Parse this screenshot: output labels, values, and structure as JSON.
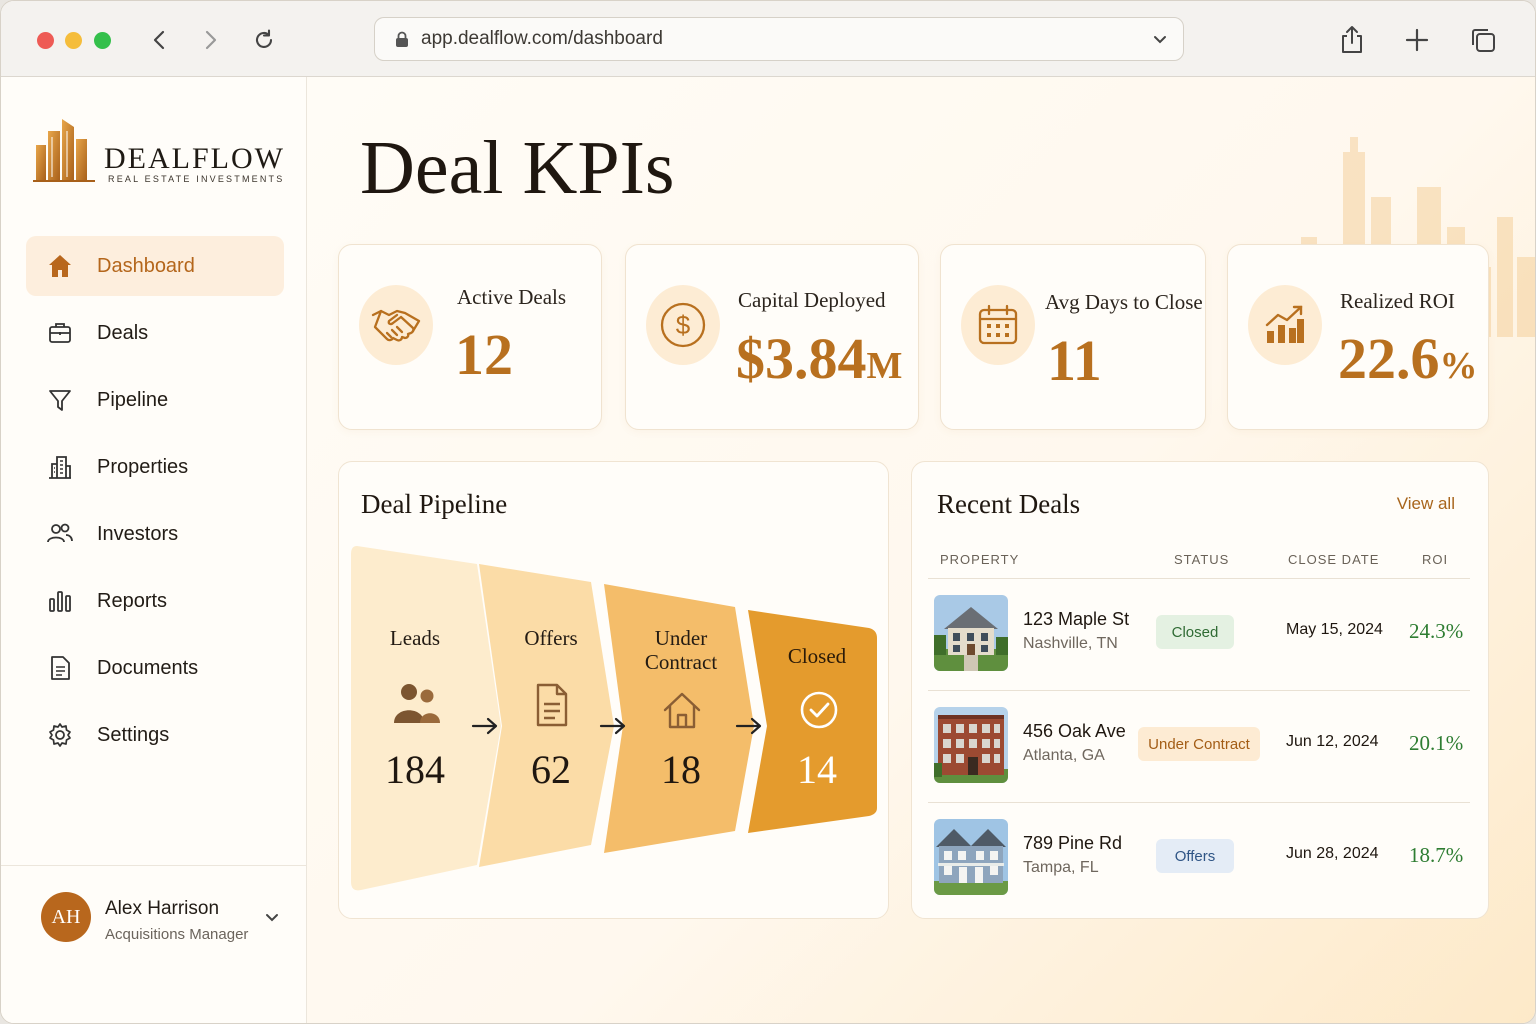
{
  "browser": {
    "url": "app.dealflow.com/dashboard"
  },
  "brand": {
    "name": "DEALFLOW",
    "tagline": "REAL ESTATE INVESTMENTS",
    "accent": "#b8701f"
  },
  "sidebar": {
    "items": [
      {
        "label": "Dashboard",
        "icon": "home-icon",
        "active": true
      },
      {
        "label": "Deals",
        "icon": "briefcase-icon"
      },
      {
        "label": "Pipeline",
        "icon": "funnel-icon"
      },
      {
        "label": "Properties",
        "icon": "building-icon"
      },
      {
        "label": "Investors",
        "icon": "users-icon"
      },
      {
        "label": "Reports",
        "icon": "bar-chart-icon"
      },
      {
        "label": "Documents",
        "icon": "document-icon"
      },
      {
        "label": "Settings",
        "icon": "gear-icon"
      }
    ]
  },
  "user": {
    "initials": "AH",
    "name": "Alex Harrison",
    "role": "Acquisitions Manager"
  },
  "page": {
    "title": "Deal KPIs"
  },
  "kpis": [
    {
      "label": "Active Deals",
      "value": "12",
      "suffix": "",
      "icon": "handshake-icon"
    },
    {
      "label": "Capital Deployed",
      "value": "$3.84",
      "suffix": "M",
      "icon": "dollar-icon"
    },
    {
      "label": "Avg Days to Close",
      "value": "11",
      "suffix": "",
      "icon": "calendar-icon"
    },
    {
      "label": "Realized ROI",
      "value": "22.6",
      "suffix": "%",
      "icon": "growth-chart-icon"
    }
  ],
  "pipeline": {
    "title": "Deal Pipeline",
    "stages": [
      {
        "label": "Leads",
        "value": "184",
        "icon": "users-icon"
      },
      {
        "label": "Offers",
        "value": "62",
        "icon": "document-icon"
      },
      {
        "label": "Under Contract",
        "value": "18",
        "icon": "house-icon"
      },
      {
        "label": "Closed",
        "value": "14",
        "icon": "check-circle-icon"
      }
    ]
  },
  "recent": {
    "title": "Recent Deals",
    "view_all": "View all",
    "headers": {
      "property": "PROPERTY",
      "status": "STATUS",
      "close_date": "CLOSE DATE",
      "roi": "ROI"
    },
    "rows": [
      {
        "name": "123 Maple St",
        "city": "Nashville, TN",
        "status": "Closed",
        "date": "May 15, 2024",
        "roi": "24.3%"
      },
      {
        "name": "456 Oak Ave",
        "city": "Atlanta, GA",
        "status": "Under Contract",
        "date": "Jun 12, 2024",
        "roi": "20.1%"
      },
      {
        "name": "789 Pine Rd",
        "city": "Tampa, FL",
        "status": "Offers",
        "date": "Jun 28, 2024",
        "roi": "18.7%"
      }
    ]
  }
}
